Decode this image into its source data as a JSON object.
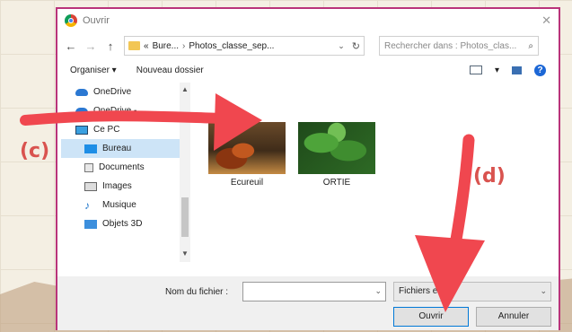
{
  "dialog": {
    "title": "Ouvrir",
    "close_symbol": "✕"
  },
  "navigation": {
    "back_symbol": "←",
    "forward_symbol": "→",
    "up_symbol": "↑",
    "address_prefix": "«",
    "address_crumbs": [
      "Bure...",
      "Photos_classe_sep..."
    ],
    "address_separator": "›",
    "dropdown_symbol": "⌄",
    "refresh_symbol": "↻",
    "search_placeholder": "Rechercher dans : Photos_clas...",
    "search_icon": "⌕"
  },
  "toolbar": {
    "organise_label": "Organiser ▾",
    "new_folder_label": "Nouveau dossier",
    "view_dropdown": "▾",
    "help_label": "?"
  },
  "sidebar": {
    "items": [
      {
        "label": "OneDrive",
        "icon": "cloud-icon"
      },
      {
        "label": "OneDrive -",
        "icon": "cloud-icon"
      },
      {
        "label": "Ce PC",
        "icon": "computer-icon"
      },
      {
        "label": "Bureau",
        "icon": "desktop-icon",
        "selected": true
      },
      {
        "label": "Documents",
        "icon": "document-icon"
      },
      {
        "label": "Images",
        "icon": "images-icon"
      },
      {
        "label": "Musique",
        "icon": "music-icon"
      },
      {
        "label": "Objets 3D",
        "icon": "objects-3d-icon"
      }
    ],
    "scroll_up": "▲",
    "scroll_down": "▼"
  },
  "files": [
    {
      "name": "Ecureuil",
      "thumb": "squirrel-photo"
    },
    {
      "name": "ORTIE",
      "thumb": "nettle-photo"
    }
  ],
  "footer": {
    "filename_label": "Nom du fichier :",
    "filename_value": "",
    "filter_value": "Fichiers        e",
    "open_button": "Ouvrir",
    "cancel_button": "Annuler"
  },
  "annotations": {
    "label_c": "(c)",
    "label_d": "(d)",
    "arrow_color": "#f0474f"
  },
  "colors": {
    "dialog_border": "#b9347a",
    "selected_bg": "#cde4f7",
    "accent": "#0078d7"
  }
}
